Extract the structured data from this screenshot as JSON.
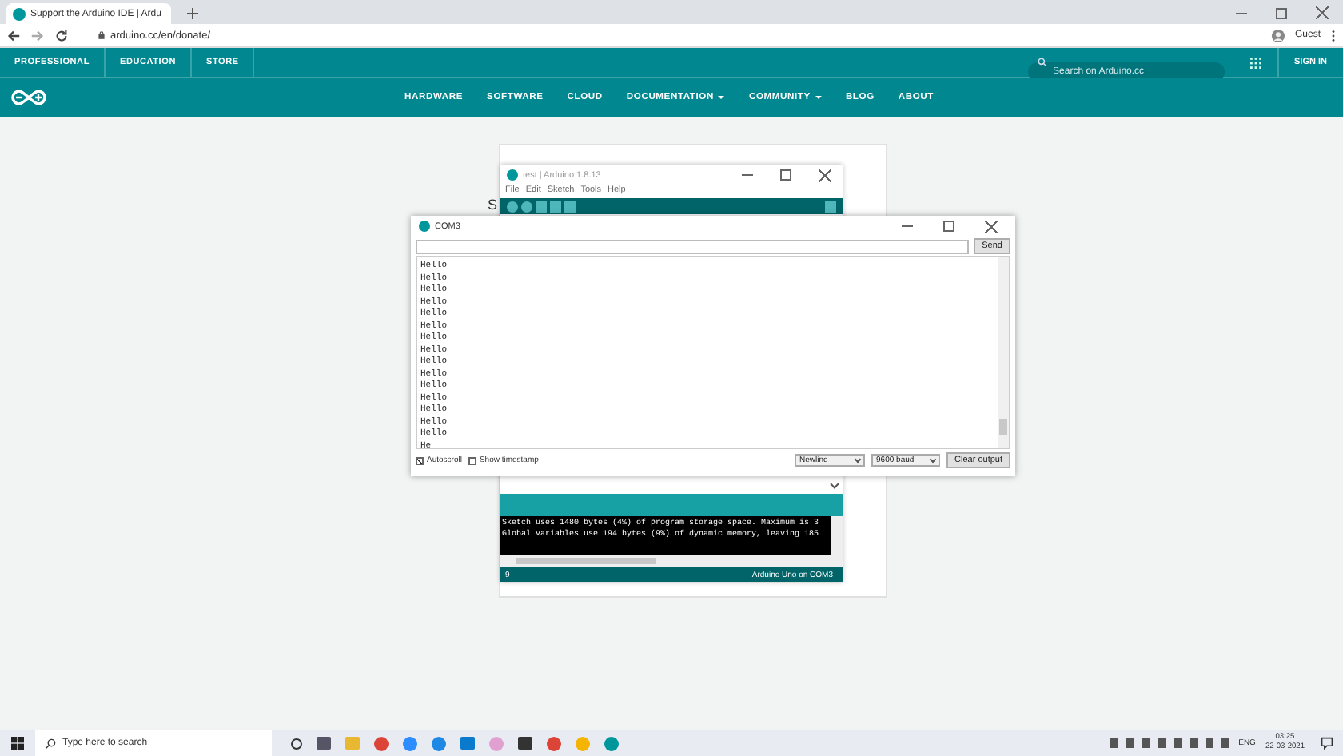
{
  "browser": {
    "tab_title": "Support the Arduino IDE | Ardu",
    "url": "arduino.cc/en/donate/",
    "profile": "Guest"
  },
  "topbar": {
    "links": [
      "PROFESSIONAL",
      "EDUCATION",
      "STORE"
    ],
    "search": {
      "placeholder": "Search on Arduino.cc"
    },
    "sign_in": "SIGN IN"
  },
  "nav": [
    {
      "label": "HARDWARE",
      "dropdown": false
    },
    {
      "label": "SOFTWARE",
      "dropdown": false
    },
    {
      "label": "CLOUD",
      "dropdown": false
    },
    {
      "label": "DOCUMENTATION",
      "dropdown": true
    },
    {
      "label": "COMMUNITY",
      "dropdown": true
    },
    {
      "label": "BLOG",
      "dropdown": false
    },
    {
      "label": "ABOUT",
      "dropdown": false
    }
  ],
  "page": {
    "heading_fragment": "S"
  },
  "ide": {
    "title": "test | Arduino 1.8.13",
    "menu": [
      "File",
      "Edit",
      "Sketch",
      "Tools",
      "Help"
    ],
    "console": [
      "Sketch uses 1480 bytes (4%) of program storage space. Maximum is 3",
      "Global variables use 194 bytes (9%) of dynamic memory, leaving 185"
    ],
    "line": "9",
    "board": "Arduino Uno on COM3"
  },
  "serial": {
    "title": "COM3",
    "send": "Send",
    "output": [
      "Hello",
      "Hello",
      "Hello",
      "Hello",
      "Hello",
      "Hello",
      "Hello",
      "Hello",
      "Hello",
      "Hello",
      "Hello",
      "Hello",
      "Hello",
      "Hello",
      "Hello",
      "He"
    ],
    "options": [
      {
        "label": "Autoscroll",
        "checked": true
      },
      {
        "label": "Show timestamp",
        "checked": false
      }
    ],
    "line_ending": "Newline",
    "baud": "9600 baud",
    "clear": "Clear output"
  },
  "taskbar": {
    "search": {
      "placeholder": "Type here to search"
    },
    "language": "ENG",
    "time": "03:25",
    "date": "22-03-2021"
  }
}
